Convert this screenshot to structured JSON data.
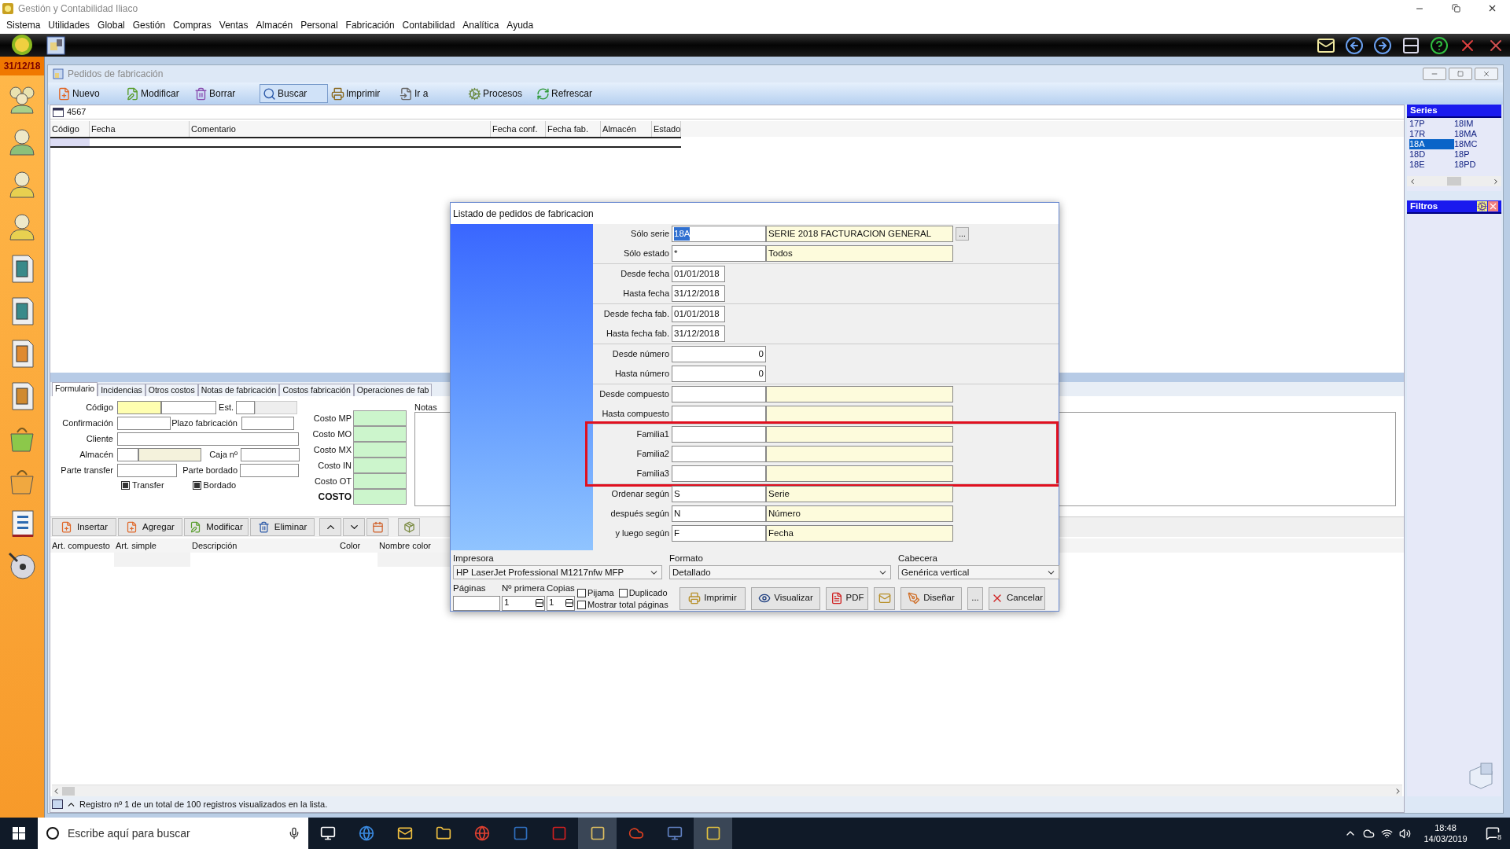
{
  "app_title": "Gestión y Contabilidad Iliaco",
  "menu": [
    "Sistema",
    "Utilidades",
    "Global",
    "Gestión",
    "Compras",
    "Ventas",
    "Almacén",
    "Personal",
    "Fabricación",
    "Contabilidad",
    "Analítica",
    "Ayuda"
  ],
  "date": "31/12/18",
  "window": {
    "title": "Pedidos de fabricación",
    "toolbar": [
      {
        "label": "Nuevo",
        "kind": "new",
        "selected": false
      },
      {
        "label": "Modificar",
        "kind": "edit",
        "selected": false
      },
      {
        "label": "Borrar",
        "kind": "delete",
        "selected": false
      },
      {
        "label": "Buscar",
        "kind": "search",
        "selected": true
      },
      {
        "label": "Imprimir",
        "kind": "print",
        "selected": false
      },
      {
        "label": "Ir a",
        "kind": "goto",
        "selected": false
      },
      {
        "label": "Procesos",
        "kind": "process",
        "selected": false
      },
      {
        "label": "Refrescar",
        "kind": "refresh",
        "selected": false
      }
    ],
    "search_value": "4567",
    "columns": [
      "Código",
      "Fecha",
      "Comentario",
      "Fecha conf.",
      "Fecha fab.",
      "Almacén",
      "Estado"
    ],
    "tabs": [
      {
        "label": "Formulario",
        "selected": true
      },
      {
        "label": "Incidencias",
        "selected": false
      },
      {
        "label": "Otros costos",
        "selected": false
      },
      {
        "label": "Notas de fabricación",
        "selected": false
      },
      {
        "label": "Costos fabricación",
        "selected": false
      },
      {
        "label": "Operaciones de fab",
        "selected": false
      }
    ],
    "form": {
      "code": "Código",
      "state": "Est.",
      "confirmation": "Confirmación",
      "term": "Plazo fabricación",
      "client": "Cliente",
      "warehouse": "Almacén",
      "box": "Caja nº",
      "transfer_part": "Parte transfer",
      "embroidery_part": "Parte bordado"
    },
    "checkboxes": [
      {
        "label": "Transfer",
        "checked": true
      },
      {
        "label": "Bordado",
        "checked": true
      }
    ],
    "costs": [
      {
        "label": "Costo MP",
        "total": false
      },
      {
        "label": "Costo MO",
        "total": false
      },
      {
        "label": "Costo MX",
        "total": false
      },
      {
        "label": "Costo IN",
        "total": false
      },
      {
        "label": "Costo OT",
        "total": false
      },
      {
        "label": "COSTO",
        "total": true
      }
    ],
    "notes_label": "Notas",
    "line_buttons": [
      {
        "label": "Insertar",
        "kind": "insert"
      },
      {
        "label": "Agregar",
        "kind": "add"
      },
      {
        "label": "Modificar",
        "kind": "edit"
      },
      {
        "label": "Eliminar",
        "kind": "delete"
      }
    ],
    "line_columns": [
      "Art. compuesto",
      "Art. simple",
      "Descripción",
      "Color",
      "Nombre color"
    ],
    "status": "Registro nº 1 de un total de 100 registros visualizados en la lista."
  },
  "series": {
    "title": "Series",
    "items": [
      {
        "label": "17P",
        "selected": false
      },
      {
        "label": "18IM",
        "selected": false
      },
      {
        "label": "17R",
        "selected": false
      },
      {
        "label": "18MA",
        "selected": false
      },
      {
        "label": "18A",
        "selected": true
      },
      {
        "label": "18MC",
        "selected": false
      },
      {
        "label": "18D",
        "selected": false
      },
      {
        "label": "18P",
        "selected": false
      },
      {
        "label": "18E",
        "selected": false
      },
      {
        "label": "18PD",
        "selected": false
      }
    ]
  },
  "filters": {
    "title": "Filtros"
  },
  "dialog": {
    "title": "Listado de pedidos de fabricacion",
    "groups": [
      {
        "highlighted": false,
        "rows": [
          {
            "kind": "lookup",
            "label": "Sólo serie",
            "code": "18A",
            "description": "SERIE 2018 FACTURACION GENERAL",
            "button": "..."
          },
          {
            "kind": "lookup",
            "label": "Sólo estado",
            "code": "*",
            "description": "Todos"
          }
        ]
      },
      {
        "highlighted": false,
        "rows": [
          {
            "kind": "date",
            "label": "Desde fecha",
            "code": "01/01/2018"
          },
          {
            "kind": "date",
            "label": "Hasta fecha",
            "code": "31/12/2018"
          }
        ]
      },
      {
        "highlighted": false,
        "rows": [
          {
            "kind": "date",
            "label": "Desde fecha fab.",
            "code": "01/01/2018"
          },
          {
            "kind": "date",
            "label": "Hasta fecha fab.",
            "code": "31/12/2018"
          }
        ]
      },
      {
        "highlighted": false,
        "rows": [
          {
            "kind": "number",
            "label": "Desde número",
            "code": "0"
          },
          {
            "kind": "number",
            "label": "Hasta número",
            "code": "0"
          }
        ]
      },
      {
        "highlighted": false,
        "rows": [
          {
            "kind": "lookup",
            "label": "Desde compuesto"
          },
          {
            "kind": "lookup",
            "label": "Hasta compuesto"
          }
        ]
      },
      {
        "highlighted": true,
        "rows": [
          {
            "kind": "lookup",
            "label": "Familia1"
          },
          {
            "kind": "lookup",
            "label": "Familia2"
          },
          {
            "kind": "lookup",
            "label": "Familia3"
          }
        ]
      },
      {
        "highlighted": false,
        "rows": [
          {
            "kind": "lookup",
            "label": "Ordenar según",
            "code": "S",
            "description": "Serie"
          },
          {
            "kind": "lookup",
            "label": "después según",
            "code": "N",
            "description": "Número"
          },
          {
            "kind": "lookup",
            "label": "y luego según",
            "code": "F",
            "description": "Fecha"
          }
        ]
      }
    ],
    "printer": {
      "label": "Impresora",
      "value": "HP LaserJet Professional M1217nfw MFP"
    },
    "format": {
      "label": "Formato",
      "value": "Detallado"
    },
    "header": {
      "label": "Cabecera",
      "value": "Genérica vertical"
    },
    "pages_label": "Páginas",
    "first_label": "Nº primera",
    "first_value": "1",
    "copies_label": "Copias",
    "copies_value": "1",
    "options": [
      {
        "label": "Pijama",
        "checked": false
      },
      {
        "label": "Duplicado",
        "checked": false
      },
      {
        "label": "Mostrar total páginas",
        "checked": false
      }
    ],
    "buttons": [
      {
        "label": "Imprimir",
        "kind": "print"
      },
      {
        "label": "Visualizar",
        "kind": "preview"
      },
      {
        "label": "PDF",
        "kind": "pdf"
      },
      {
        "kind": "mail"
      },
      {
        "label": "Diseñar",
        "kind": "design"
      },
      {
        "label": "...",
        "kind": "more"
      },
      {
        "label": "Cancelar",
        "kind": "cancel"
      }
    ]
  },
  "taskbar": {
    "search_placeholder": "Escribe aquí para buscar",
    "time": "18:48",
    "date": "14/03/2019",
    "notifications": "8"
  }
}
